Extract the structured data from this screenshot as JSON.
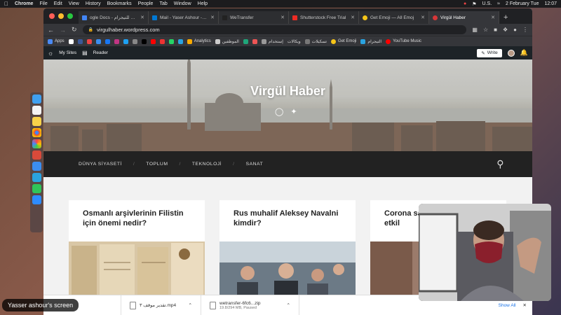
{
  "menubar": {
    "items": [
      "Chrome",
      "File",
      "Edit",
      "View",
      "History",
      "Bookmarks",
      "People",
      "Tab",
      "Window",
      "Help"
    ],
    "locale": "U.S.",
    "date": "2 February Tue",
    "time": "12:07"
  },
  "browser": {
    "tabs": [
      {
        "label": "ogle Docs - نماذج للتيجرام",
        "color": "#4285f4"
      },
      {
        "label": "Mail - Yaser Ashour - Ou",
        "color": "#0078d4"
      },
      {
        "label": "WeTransfer",
        "color": "#222222"
      },
      {
        "label": "Shutterstock Free Trial",
        "color": "#ee2b24"
      },
      {
        "label": "Get Emoji — All Emoj",
        "color": "#f5c518"
      },
      {
        "label": "Virgül Haber",
        "color": "#d63638",
        "active": true
      }
    ],
    "new_tab": "+",
    "url": "virgulhaber.wordpress.com",
    "bookmarks": [
      "Apps",
      "Analytics",
      "الموظفين",
      "إستخدام",
      "ويكالات",
      "تسكيلات",
      "Get Emoji",
      "التيجرام",
      "YouTube Music"
    ]
  },
  "wp_admin": {
    "my_sites": "My Sites",
    "reader": "Reader",
    "write": "Write"
  },
  "site": {
    "title": "Virgül Haber",
    "nav": [
      "DÜNYA SİYASETİ",
      "TOPLUM",
      "TEKNOLOJİ",
      "SANAT"
    ],
    "posts": [
      {
        "title": "Osmanlı arşivlerinin Filistin için önemi nedir?"
      },
      {
        "title": "Rus muhalif Aleksey Navalni kimdir?"
      },
      {
        "title": "Corona sa yabancı k nasıl etkil"
      }
    ]
  },
  "downloads": [
    {
      "name": "تقدير موقف ٣.mp4",
      "sub": ""
    },
    {
      "name": "wetransfer-6fc6...zip",
      "sub": "19.8/294 MB, Paused"
    }
  ],
  "download_show_all": "Show All",
  "screen_label": "Yasser ashour's screen"
}
